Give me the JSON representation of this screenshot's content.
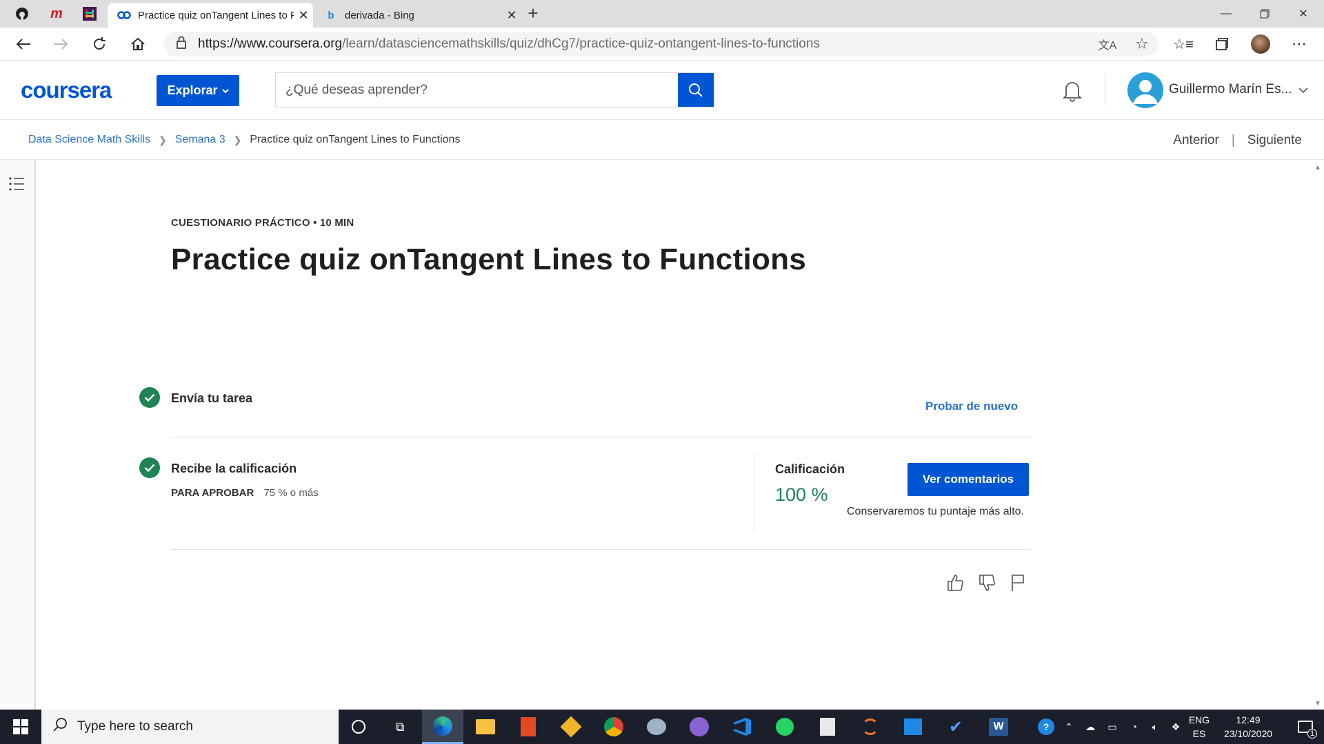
{
  "browser": {
    "tabs": [
      {
        "title": "Practice quiz onTangent Lines to Functions",
        "active": true
      },
      {
        "title": "derivada - Bing",
        "active": false
      }
    ],
    "url_host": "https://www.coursera.org",
    "url_path": "/learn/datasciencemathskills/quiz/dhCg7/practice-quiz-ontangent-lines-to-functions"
  },
  "header": {
    "logo": "coursera",
    "explore_label": "Explorar",
    "search_placeholder": "¿Qué deseas aprender?",
    "user_name": "Guillermo Marín Es..."
  },
  "breadcrumb": {
    "course": "Data Science Math Skills",
    "week": "Semana 3",
    "current": "Practice quiz onTangent Lines to Functions"
  },
  "pager": {
    "prev": "Anterior",
    "separator": "|",
    "next": "Siguiente"
  },
  "quiz": {
    "kicker": "CUESTIONARIO PRÁCTICO • 10 MIN",
    "title": "Practice quiz onTangent Lines to Functions",
    "step1_label": "Envía tu tarea",
    "retry_label": "Probar de nuevo",
    "step2_label": "Recibe la calificación",
    "pass_label": "PARA APROBAR",
    "pass_value": "75 % o más",
    "grade_label": "Calificación",
    "grade_value": "100 %",
    "feedback_button": "Ver comentarios",
    "keep_highest": "Conservaremos tu puntaje más alto."
  },
  "taskbar": {
    "search_placeholder": "Type here to search",
    "lang_top": "ENG",
    "lang_bottom": "ES",
    "time": "12:49",
    "date": "23/10/2020",
    "notification_count": "1"
  },
  "colors": {
    "coursera_blue": "#0056d2",
    "link_blue": "#2a73cc",
    "success_green": "#1f8354",
    "taskbar": "#1a1f2b"
  }
}
